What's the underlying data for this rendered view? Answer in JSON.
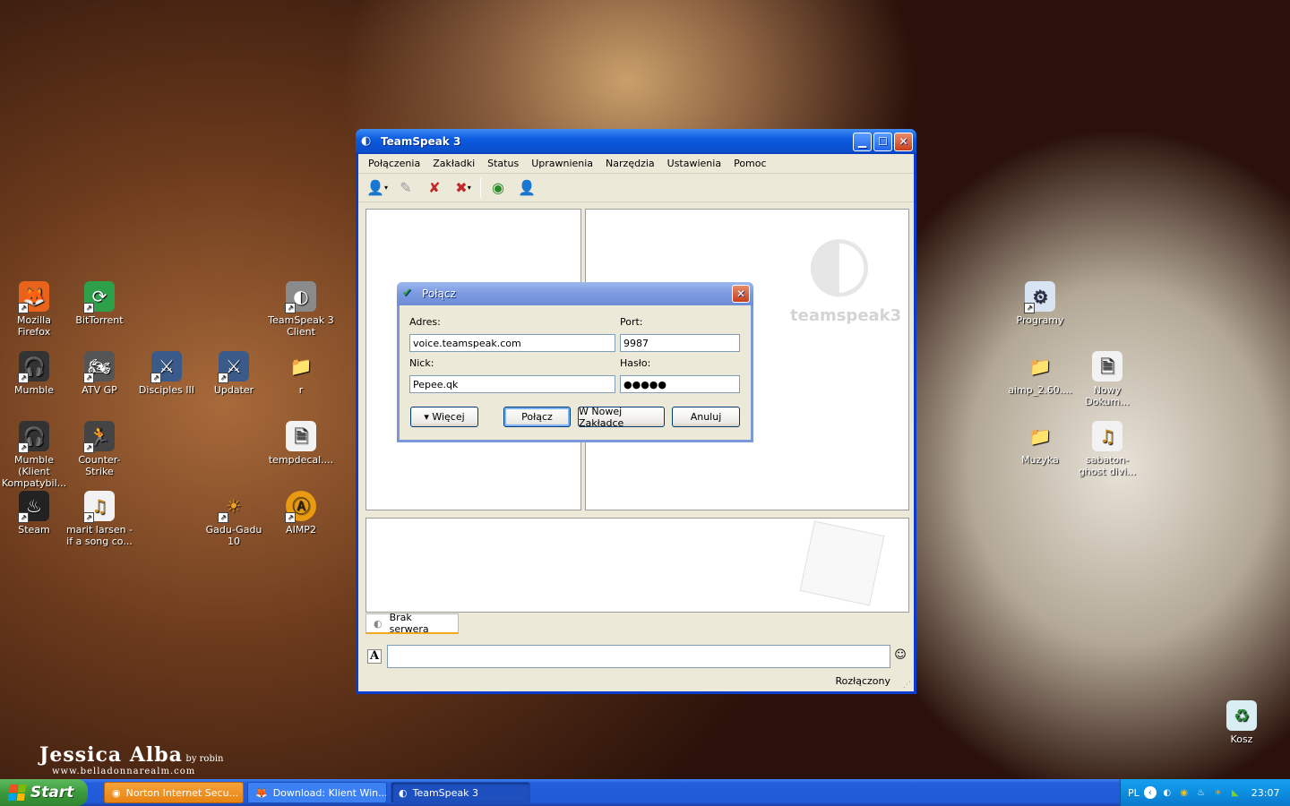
{
  "desktop": {
    "icons": [
      {
        "label": "Mozilla Firefox",
        "glyph": "🦊",
        "color": "#e8641c"
      },
      {
        "label": "BitTorrent",
        "glyph": "⟳",
        "color": "#2ea04a"
      },
      {
        "label": "TeamSpeak 3 Client",
        "glyph": "◐",
        "color": "#8a8a8a"
      },
      {
        "label": "Mumble",
        "glyph": "🎧",
        "color": "#333333"
      },
      {
        "label": "ATV GP",
        "glyph": "🏍",
        "color": "#555555"
      },
      {
        "label": "Disciples III",
        "glyph": "⚔",
        "color": "#3a5a8a"
      },
      {
        "label": "Updater",
        "glyph": "⚔",
        "color": "#3a5a8a"
      },
      {
        "label": "r",
        "glyph": "📁",
        "color": "#e8c440"
      },
      {
        "label": "Mumble (Klient Kompatybil...",
        "glyph": "🎧",
        "color": "#333333"
      },
      {
        "label": "Counter-Strike",
        "glyph": "🏃",
        "color": "#444444"
      },
      {
        "label": "tempdecal....",
        "glyph": "🗎",
        "color": "#f2f2f2"
      },
      {
        "label": "Steam",
        "glyph": "♨",
        "color": "#222222"
      },
      {
        "label": "marit larsen - if a song co...",
        "glyph": "♫",
        "color": "#f2f2f2"
      },
      {
        "label": "Gadu-Gadu 10",
        "glyph": "☀",
        "color": "#f2a020"
      },
      {
        "label": "AIMP2",
        "glyph": "Ⓐ",
        "color": "#e89a10"
      },
      {
        "label": "Programy",
        "glyph": "⚙",
        "color": "#d8e4f2"
      },
      {
        "label": "aimp_2.60....",
        "glyph": "📁",
        "color": "#e8c440"
      },
      {
        "label": "Nowy Dokum...",
        "glyph": "🗎",
        "color": "#f2f2f2"
      },
      {
        "label": "Muzyka",
        "glyph": "📁",
        "color": "#e8c440"
      },
      {
        "label": "sabaton-ghost divi...",
        "glyph": "♫",
        "color": "#f2f2f2"
      },
      {
        "label": "Kosz",
        "glyph": "♻",
        "color": "#d8eef2"
      }
    ],
    "watermark": {
      "name": "Jessica Alba",
      "by": "by robin",
      "url": "www.belladonnarealm.com"
    }
  },
  "window": {
    "title": "TeamSpeak 3",
    "menu": [
      "Połączenia",
      "Zakładki",
      "Status",
      "Uprawnienia",
      "Narzędzia",
      "Ustawienia",
      "Pomoc"
    ],
    "logo_text": "teamspeak3",
    "tab_label": "Brak serwera",
    "chat_placeholder": "",
    "status_text": "Rozłączony"
  },
  "dialog": {
    "title": "Połącz",
    "address_label": "Adres:",
    "address_value": "voice.teamspeak.com",
    "port_label": "Port:",
    "port_value": "9987",
    "nick_label": "Nick:",
    "nick_value": "Pepee.qk",
    "password_label": "Hasło:",
    "password_value": "●●●●●",
    "more_button": "▾ Więcej",
    "connect_button": "Połącz",
    "new_tab_button": "W Nowej Zakładce",
    "cancel_button": "Anuluj"
  },
  "taskbar": {
    "start_label": "Start",
    "tasks": [
      {
        "label": "Norton Internet Secu...",
        "glyph": "◉"
      },
      {
        "label": "Download: Klient Win...",
        "glyph": "🦊"
      },
      {
        "label": "TeamSpeak 3",
        "glyph": "◐"
      }
    ],
    "lang": "PL",
    "clock": "23:07"
  },
  "colors": {
    "xp_blue": "#0a3cce",
    "accent_orange": "#f5a623"
  }
}
